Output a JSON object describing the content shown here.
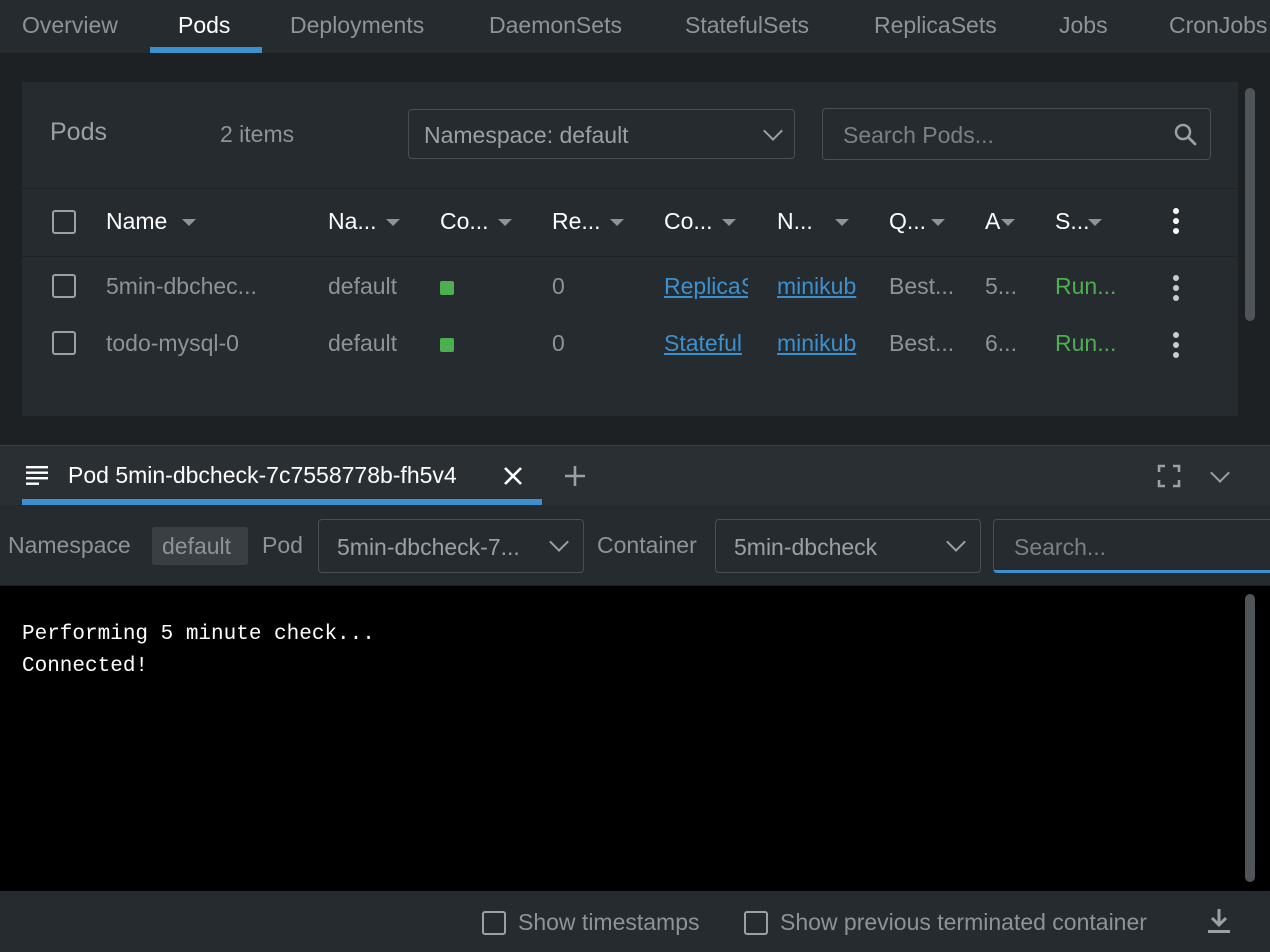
{
  "top_tabs": [
    "Overview",
    "Pods",
    "Deployments",
    "DaemonSets",
    "StatefulSets",
    "ReplicaSets",
    "Jobs",
    "CronJobs"
  ],
  "active_tab": "Pods",
  "pods_panel": {
    "title": "Pods",
    "count": "2 items",
    "namespace_select": "Namespace: default",
    "search_placeholder": "Search Pods..."
  },
  "table": {
    "headers": [
      "Name",
      "Na...",
      "Co...",
      "Re...",
      "Co...",
      "N...",
      "Q...",
      "A",
      "S..."
    ],
    "rows": [
      {
        "name": "5min-dbchec...",
        "namespace": "default",
        "restarts": "0",
        "controlled_by": "ReplicaS",
        "node": "minikub",
        "qos": "Best...",
        "age": "5...",
        "status": "Run..."
      },
      {
        "name": "todo-mysql-0",
        "namespace": "default",
        "restarts": "0",
        "controlled_by": "Stateful",
        "node": "minikub",
        "qos": "Best...",
        "age": "6...",
        "status": "Run..."
      }
    ]
  },
  "dock": {
    "tab_title": "Pod 5min-dbcheck-7c7558778b-fh5v4",
    "namespace_label": "Namespace",
    "namespace_value": "default",
    "pod_label": "Pod",
    "pod_value": "5min-dbcheck-7...",
    "container_label": "Container",
    "container_value": "5min-dbcheck",
    "search_placeholder": "Search..."
  },
  "logs": [
    "Performing 5 minute check...",
    "Connected!"
  ],
  "footer": {
    "show_timestamps": "Show timestamps",
    "show_previous": "Show previous terminated container"
  },
  "colors": {
    "accent": "#3d90ce",
    "running": "#4caf50",
    "background": "#1e2124"
  }
}
